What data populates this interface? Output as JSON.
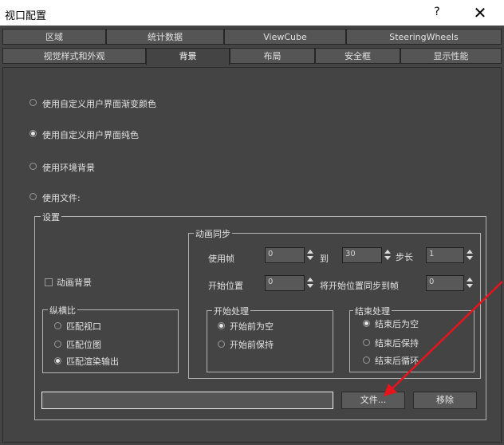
{
  "window": {
    "title": "视口配置",
    "help": "?",
    "close": "✕"
  },
  "tabs_top": [
    "区域",
    "统计数据",
    "ViewCube",
    "SteeringWheels"
  ],
  "tabs_bottom": [
    "视觉样式和外观",
    "背景",
    "布局",
    "安全框",
    "显示性能"
  ],
  "active_tab": "背景",
  "background_options": {
    "gradient": "使用自定义用户界面渐变颜色",
    "solid": "使用自定义用户界面纯色",
    "environment": "使用环境背景",
    "file": "使用文件:",
    "selected": "solid"
  },
  "settings": {
    "label": "设置",
    "animate_background": "动画背景",
    "animate_background_checked": false,
    "aspect": {
      "label": "纵横比",
      "match_viewport": "匹配视口",
      "match_bitmap": "匹配位图",
      "match_render": "匹配渲染输出",
      "selected": "match_render"
    },
    "anim_sync": {
      "label": "动画同步",
      "use_frame": "使用帧",
      "use_frame_value": "0",
      "to": "到",
      "to_value": "30",
      "step": "步长",
      "step_value": "1",
      "start_pos": "开始位置",
      "start_pos_value": "0",
      "sync_label": "将开始位置同步到帧",
      "sync_value": "0",
      "start_processing": {
        "label": "开始处理",
        "blank_before": "开始前为空",
        "hold_before": "开始前保持",
        "selected": "blank_before"
      },
      "end_processing": {
        "label": "结束处理",
        "blank_after": "结束后为空",
        "hold_after": "结束后保持",
        "loop_after": "结束后循环",
        "selected": "blank_after"
      }
    }
  },
  "file_path": "",
  "buttons": {
    "files": "文件...",
    "remove": "移除"
  },
  "colors": {
    "bg": "#444444",
    "annotation": "#e8141c"
  }
}
